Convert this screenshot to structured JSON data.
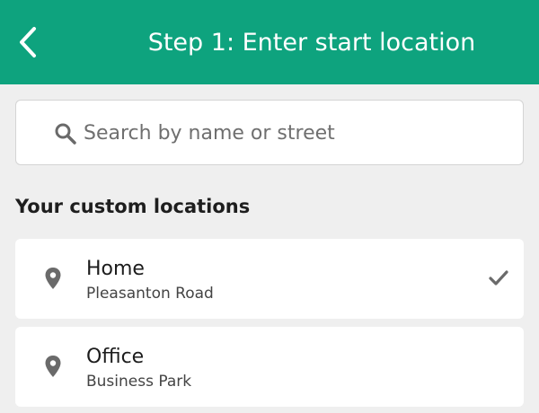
{
  "header": {
    "title": "Step 1: Enter start location",
    "back_icon": "chevron-left-icon"
  },
  "search": {
    "placeholder": "Search by name or street",
    "value": "",
    "icon": "search-icon"
  },
  "section": {
    "heading": "Your custom locations"
  },
  "locations": [
    {
      "name": "Home",
      "subtitle": "Pleasanton Road",
      "selected": true,
      "icon": "location-pin-icon"
    },
    {
      "name": "Office",
      "subtitle": "Business Park",
      "selected": false,
      "icon": "location-pin-icon"
    }
  ],
  "colors": {
    "accent": "#0ea37e",
    "background": "#efefef",
    "icon": "#6a6a6a"
  }
}
